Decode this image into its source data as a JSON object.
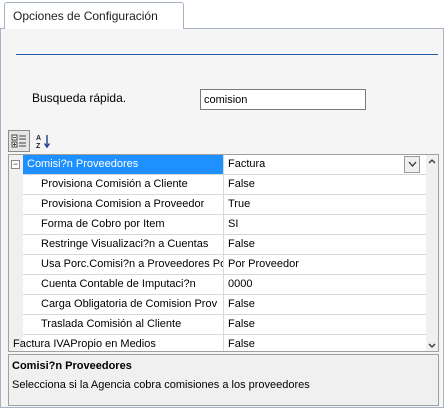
{
  "tab": {
    "label": "Opciones de Configuración"
  },
  "search": {
    "label": "Busqueda rápida.",
    "value": "comision"
  },
  "grid": {
    "category": {
      "name": "Comisi?n  Proveedores",
      "value": "Factura"
    },
    "rows": [
      {
        "name": "Provisiona Comisión a Cliente",
        "value": "False"
      },
      {
        "name": "Provisiona Comision a Proveedor",
        "value": "True"
      },
      {
        "name": "Forma de Cobro por Item",
        "value": "SI"
      },
      {
        "name": "Restringe Visualizaci?n a Cuentas",
        "value": "False"
      },
      {
        "name": "Usa Porc.Comisi?n a Proveedores Por",
        "value": "Por Proveedor"
      },
      {
        "name": "Cuenta Contable de Imputaci?n",
        "value": "0000"
      },
      {
        "name": "Carga Obligatoria de Comision Prov",
        "value": "False"
      },
      {
        "name": "Traslada Comisión al Cliente",
        "value": "False"
      }
    ],
    "partial_row": {
      "name": "Factura IVAPropio en Medios",
      "value": "False"
    }
  },
  "description": {
    "title": "Comisi?n  Proveedores",
    "text": "Selecciona  si la Agencia cobra comisiones a los proveedores"
  },
  "colors": {
    "selection": "#1e90ff",
    "separator": "#1f5fa8"
  },
  "icons": [
    "categorized-icon",
    "alphabetical-sort-icon",
    "collapse-icon",
    "dropdown-arrow-icon",
    "scroll-up-icon",
    "scroll-down-icon"
  ]
}
